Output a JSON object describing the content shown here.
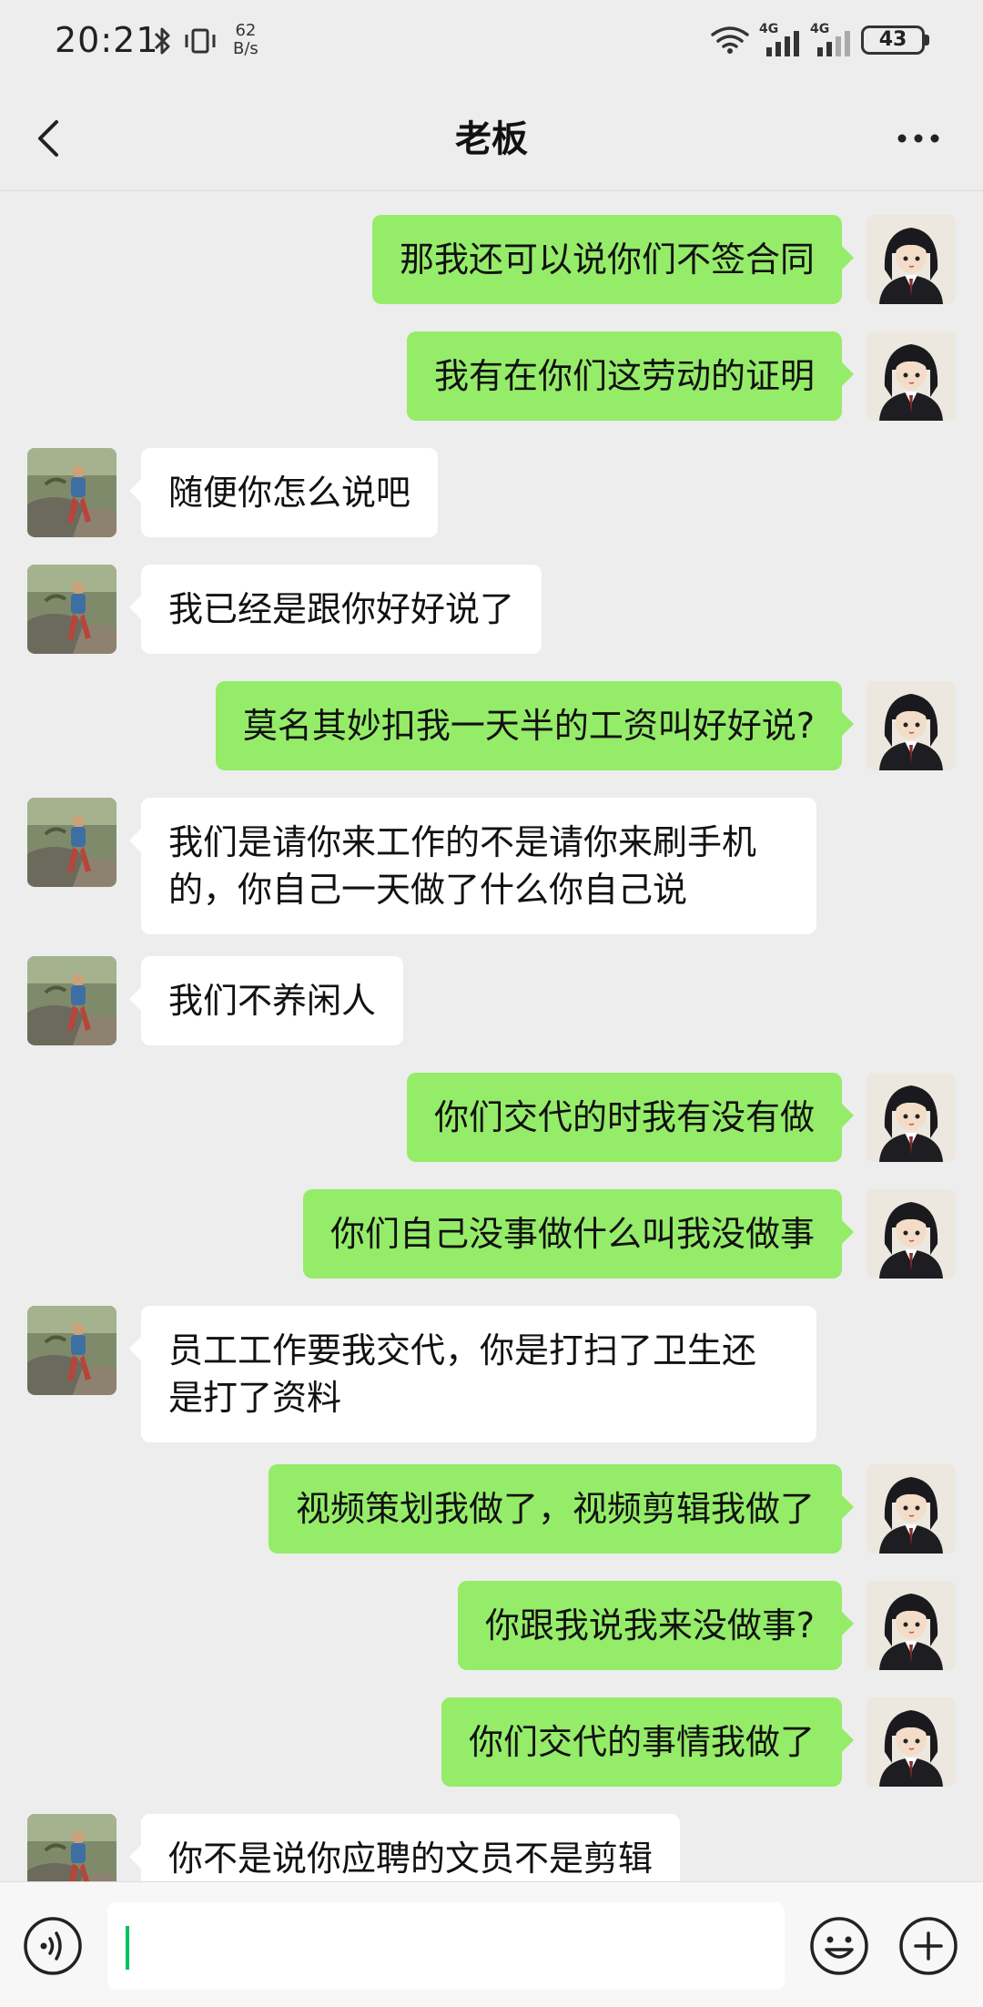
{
  "status_bar": {
    "time": "20:21",
    "net_speed_value": "62",
    "net_speed_unit": "B/s",
    "signal_1_label": "4G",
    "signal_2_label": "4G",
    "battery": "43",
    "icons": [
      "bluetooth-icon",
      "vibrate-icon",
      "wifi-icon",
      "signal-icon",
      "signal-icon",
      "battery-icon"
    ]
  },
  "header": {
    "title": "老板",
    "back_icon": "chevron-left-icon",
    "more_icon": "more-dots-icon"
  },
  "messages": [
    {
      "side": "sent",
      "text": "那我还可以说你们不签合同"
    },
    {
      "side": "sent",
      "text": "我有在你们这劳动的证明"
    },
    {
      "side": "recv",
      "text": "随便你怎么说吧"
    },
    {
      "side": "recv",
      "text": "我已经是跟你好好说了"
    },
    {
      "side": "sent",
      "text": "莫名其妙扣我一天半的工资叫好好说?"
    },
    {
      "side": "recv",
      "text": "我们是请你来工作的不是请你来刷手机的，你自己一天做了什么你自己说"
    },
    {
      "side": "recv",
      "text": "我们不养闲人"
    },
    {
      "side": "sent",
      "text": "你们交代的时我有没有做"
    },
    {
      "side": "sent",
      "text": "你们自己没事做什么叫我没做事"
    },
    {
      "side": "recv",
      "text": "员工工作要我交代，你是打扫了卫生还是打了资料"
    },
    {
      "side": "sent",
      "text": "视频策划我做了，视频剪辑我做了"
    },
    {
      "side": "sent",
      "text": "你跟我说我来没做事?"
    },
    {
      "side": "sent",
      "text": "你们交代的事情我做了"
    },
    {
      "side": "recv",
      "text": "你不是说你应聘的文员不是剪辑"
    }
  ],
  "input_bar": {
    "voice_icon": "voice-icon",
    "emoji_icon": "emoji-icon",
    "plus_icon": "plus-icon",
    "accent": "#07c160"
  },
  "colors": {
    "background": "#ededed",
    "sent_bubble": "#95ec69",
    "recv_bubble": "#ffffff"
  }
}
